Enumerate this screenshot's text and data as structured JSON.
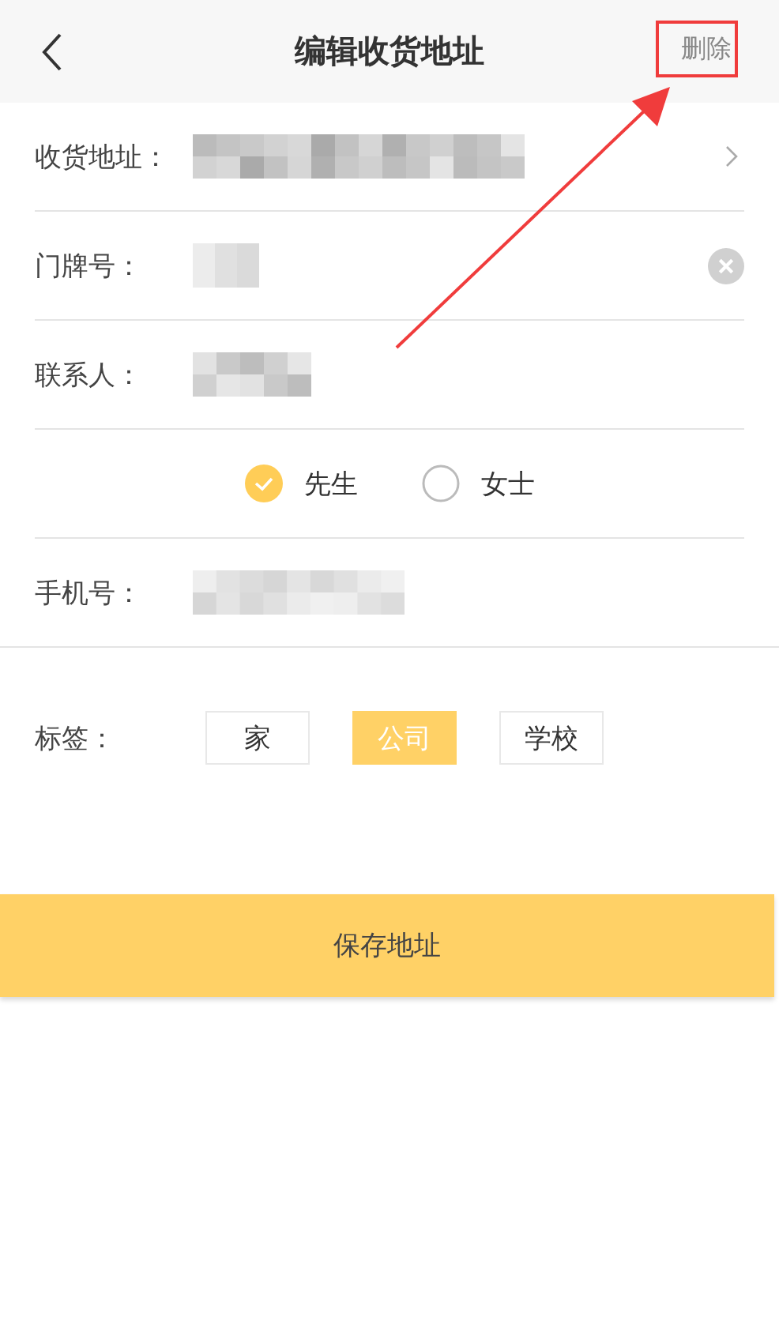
{
  "header": {
    "title": "编辑收货地址",
    "action": "删除"
  },
  "fields": [
    {
      "label": "收货地址：",
      "kind": "select"
    },
    {
      "label": "门牌号：",
      "kind": "clearable"
    },
    {
      "label": "联系人：",
      "kind": "plain"
    }
  ],
  "gender": [
    {
      "label": "先生",
      "selected": true
    },
    {
      "label": "女士",
      "selected": false
    }
  ],
  "phone": {
    "label": "手机号："
  },
  "tags": {
    "label": "标签：",
    "options": [
      {
        "label": "家",
        "selected": false
      },
      {
        "label": "公司",
        "selected": true
      },
      {
        "label": "学校",
        "selected": false
      }
    ]
  },
  "save_button": "保存地址"
}
